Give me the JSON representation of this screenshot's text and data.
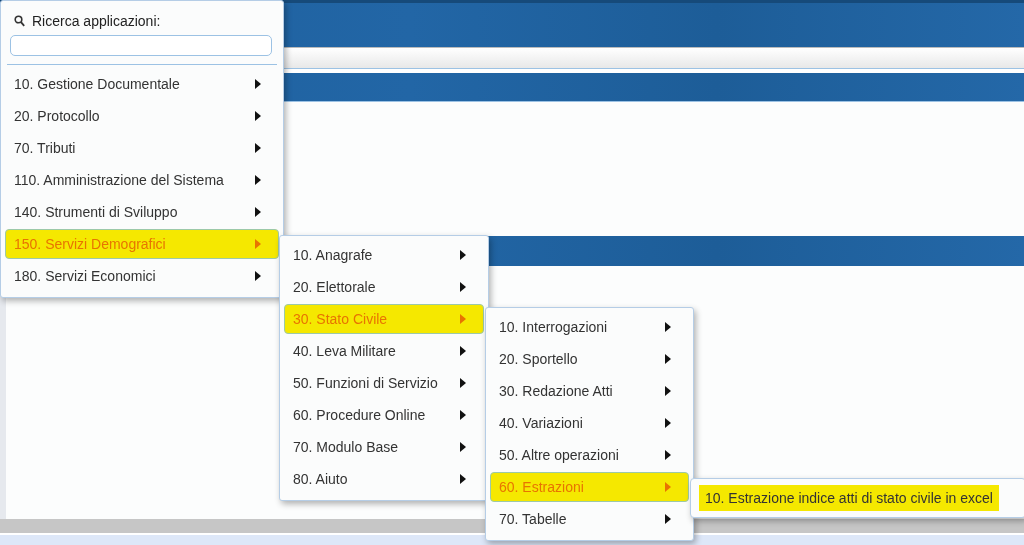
{
  "search": {
    "label": "Ricerca applicazioni:"
  },
  "menus": [
    {
      "items": [
        {
          "label": "10. Gestione Documentale",
          "selected": false,
          "submenu": true
        },
        {
          "label": "20. Protocollo",
          "selected": false,
          "submenu": true
        },
        {
          "label": "70. Tributi",
          "selected": false,
          "submenu": true
        },
        {
          "label": "110. Amministrazione del Sistema",
          "selected": false,
          "submenu": true
        },
        {
          "label": "140. Strumenti di Sviluppo",
          "selected": false,
          "submenu": true
        },
        {
          "label": "150. Servizi Demografici",
          "selected": true,
          "submenu": true
        },
        {
          "label": "180. Servizi Economici",
          "selected": false,
          "submenu": true
        }
      ]
    },
    {
      "items": [
        {
          "label": "10. Anagrafe",
          "selected": false,
          "submenu": true
        },
        {
          "label": "20. Elettorale",
          "selected": false,
          "submenu": true
        },
        {
          "label": "30. Stato Civile",
          "selected": true,
          "submenu": true
        },
        {
          "label": "40. Leva Militare",
          "selected": false,
          "submenu": true
        },
        {
          "label": "50. Funzioni di Servizio",
          "selected": false,
          "submenu": true
        },
        {
          "label": "60. Procedure Online",
          "selected": false,
          "submenu": true
        },
        {
          "label": "70. Modulo Base",
          "selected": false,
          "submenu": true
        },
        {
          "label": "80. Aiuto",
          "selected": false,
          "submenu": true
        }
      ]
    },
    {
      "items": [
        {
          "label": "10. Interrogazioni",
          "selected": false,
          "submenu": true
        },
        {
          "label": "20. Sportello",
          "selected": false,
          "submenu": true
        },
        {
          "label": "30. Redazione Atti",
          "selected": false,
          "submenu": true
        },
        {
          "label": "40. Variazioni",
          "selected": false,
          "submenu": true
        },
        {
          "label": "50. Altre operazioni",
          "selected": false,
          "submenu": true
        },
        {
          "label": "60. Estrazioni",
          "selected": true,
          "submenu": true
        },
        {
          "label": "70. Tabelle",
          "selected": false,
          "submenu": true
        }
      ]
    },
    {
      "items": [
        {
          "label": "10. Estrazione indice atti di stato civile in excel",
          "selected": true,
          "submenu": false
        }
      ]
    }
  ]
}
